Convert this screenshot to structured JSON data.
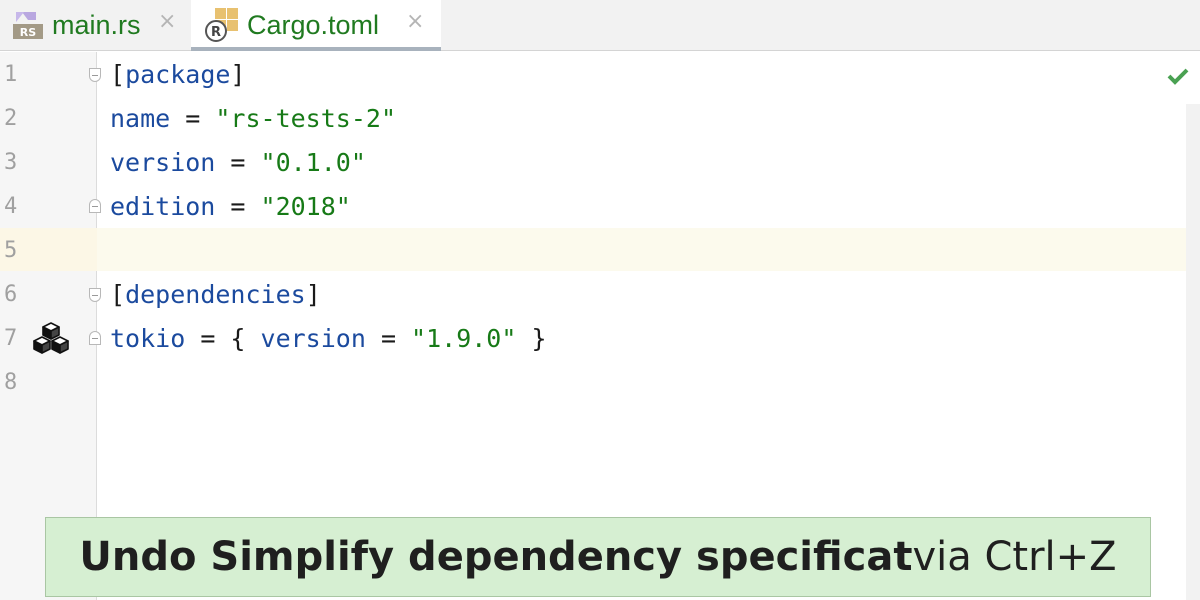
{
  "tabs": [
    {
      "label": "main.rs",
      "icon": "rust-file-icon",
      "icon_text": "RS",
      "active": false
    },
    {
      "label": "Cargo.toml",
      "icon": "cargo-file-icon",
      "active": true
    }
  ],
  "close_glyph": "×",
  "editor": {
    "lines": [
      {
        "n": "1",
        "tokens": [
          [
            "p",
            "["
          ],
          [
            "k",
            "package"
          ],
          [
            "p",
            "]"
          ]
        ]
      },
      {
        "n": "2",
        "tokens": [
          [
            "k",
            "name"
          ],
          [
            "p",
            " = "
          ],
          [
            "s",
            "\"rs-tests-2\""
          ]
        ]
      },
      {
        "n": "3",
        "tokens": [
          [
            "k",
            "version"
          ],
          [
            "p",
            " = "
          ],
          [
            "s",
            "\"0.1.0\""
          ]
        ]
      },
      {
        "n": "4",
        "tokens": [
          [
            "k",
            "edition"
          ],
          [
            "p",
            " = "
          ],
          [
            "s",
            "\"2018\""
          ]
        ]
      },
      {
        "n": "5",
        "tokens": []
      },
      {
        "n": "6",
        "tokens": [
          [
            "p",
            "["
          ],
          [
            "k",
            "dependencies"
          ],
          [
            "p",
            "]"
          ]
        ]
      },
      {
        "n": "7",
        "tokens": [
          [
            "k",
            "tokio"
          ],
          [
            "p",
            " = { "
          ],
          [
            "k",
            "version"
          ],
          [
            "p",
            " = "
          ],
          [
            "s",
            "\"1.9.0\""
          ],
          [
            "p",
            " }"
          ]
        ]
      },
      {
        "n": "8",
        "tokens": []
      }
    ],
    "current_line": "5",
    "inspection_status": "ok"
  },
  "banner": {
    "action": "Undo Simplify dependency specificat",
    "shortcut_text": " via Ctrl+Z"
  },
  "colors": {
    "keyword": "#1b4a9e",
    "string": "#177a17",
    "tab_label": "#207a20",
    "banner_bg": "#d6efd2"
  }
}
